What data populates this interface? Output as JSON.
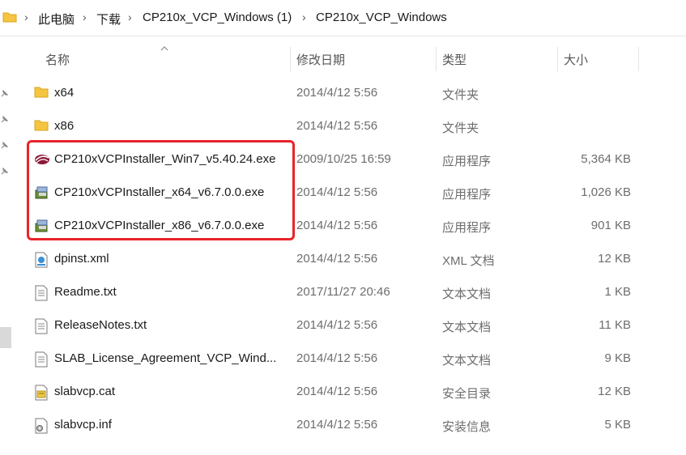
{
  "breadcrumb": [
    {
      "label": "此电脑"
    },
    {
      "label": "下载"
    },
    {
      "label": "CP210x_VCP_Windows (1)"
    },
    {
      "label": "CP210x_VCP_Windows"
    }
  ],
  "columns": {
    "name": "名称",
    "date": "修改日期",
    "type": "类型",
    "size": "大小"
  },
  "files": [
    {
      "name": "x64",
      "date": "2014/4/12 5:56",
      "type": "文件夹",
      "size": "",
      "icon": "folder-icon"
    },
    {
      "name": "x86",
      "date": "2014/4/12 5:56",
      "type": "文件夹",
      "size": "",
      "icon": "folder-icon"
    },
    {
      "name": "CP210xVCPInstaller_Win7_v5.40.24.exe",
      "date": "2009/10/25 16:59",
      "type": "应用程序",
      "size": "5,364 KB",
      "icon": "installer-logo-icon"
    },
    {
      "name": "CP210xVCPInstaller_x64_v6.7.0.0.exe",
      "date": "2014/4/12 5:56",
      "type": "应用程序",
      "size": "1,026 KB",
      "icon": "installer-box-icon"
    },
    {
      "name": "CP210xVCPInstaller_x86_v6.7.0.0.exe",
      "date": "2014/4/12 5:56",
      "type": "应用程序",
      "size": "901 KB",
      "icon": "installer-box-icon"
    },
    {
      "name": "dpinst.xml",
      "date": "2014/4/12 5:56",
      "type": "XML 文档",
      "size": "12 KB",
      "icon": "xml-file-icon"
    },
    {
      "name": "Readme.txt",
      "date": "2017/11/27 20:46",
      "type": "文本文档",
      "size": "1 KB",
      "icon": "text-file-icon"
    },
    {
      "name": "ReleaseNotes.txt",
      "date": "2014/4/12 5:56",
      "type": "文本文档",
      "size": "11 KB",
      "icon": "text-file-icon"
    },
    {
      "name": "SLAB_License_Agreement_VCP_Wind...",
      "date": "2014/4/12 5:56",
      "type": "文本文档",
      "size": "9 KB",
      "icon": "text-file-icon"
    },
    {
      "name": "slabvcp.cat",
      "date": "2014/4/12 5:56",
      "type": "安全目录",
      "size": "12 KB",
      "icon": "catalog-file-icon"
    },
    {
      "name": "slabvcp.inf",
      "date": "2014/4/12 5:56",
      "type": "安装信息",
      "size": "5 KB",
      "icon": "setup-info-file-icon"
    }
  ],
  "colors": {
    "highlight": "#e8242a",
    "folder": "#f5c542"
  }
}
